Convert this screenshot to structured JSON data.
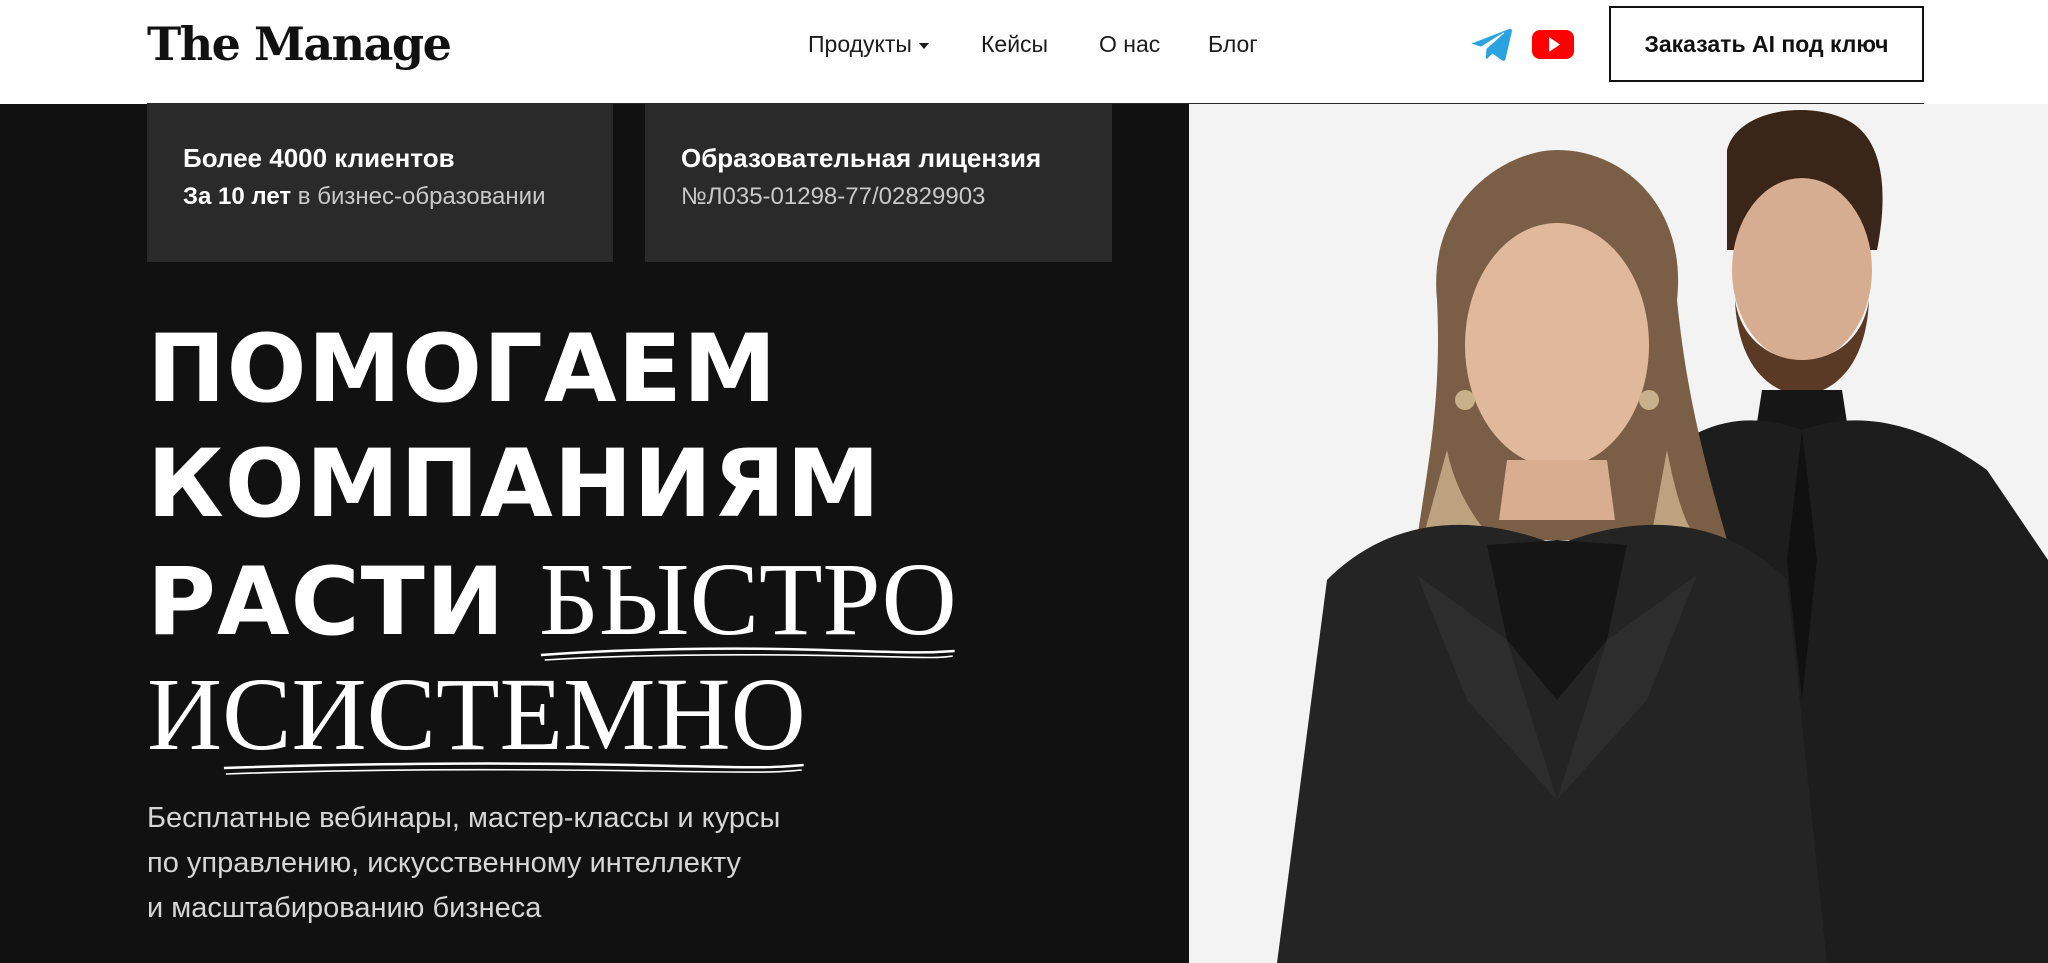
{
  "header": {
    "logo": "The Manage",
    "nav": [
      {
        "label": "Продукты",
        "has_dropdown": true
      },
      {
        "label": "Кейсы"
      },
      {
        "label": "О нас"
      },
      {
        "label": "Блог"
      }
    ],
    "social": [
      {
        "icon": "telegram-icon",
        "color": "#2AA3E0"
      },
      {
        "icon": "youtube-icon",
        "color": "#FF0000"
      }
    ],
    "cta_label": "Заказать AI под ключ"
  },
  "stats": [
    {
      "title": "Более 4000 клиентов",
      "sub_bold": "За 10 лет",
      "sub_rest": " в бизнес-образовании"
    },
    {
      "title": "Образовательная лицензия",
      "sub_bold": "",
      "sub_rest": "№Л035-01298-77/02829903"
    }
  ],
  "hero": {
    "line1": "ПОМОГАЕМ",
    "line2": "КОМПАНИЯМ",
    "line3_sans": "РАСТИ ",
    "line3_serif": "БЫСТРО",
    "line4_a": "И ",
    "line4_serif": "СИСТЕМНО",
    "description": [
      "Бесплатные вебинары, мастер-классы и курсы",
      "по управлению, искусственному интеллекту",
      "и масштабированию бизнеса"
    ]
  },
  "colors": {
    "hero_bg": "#111111",
    "card_bg": "#2a2a2a",
    "photo_bg": "#f3f3f3",
    "text_primary": "#111111"
  }
}
